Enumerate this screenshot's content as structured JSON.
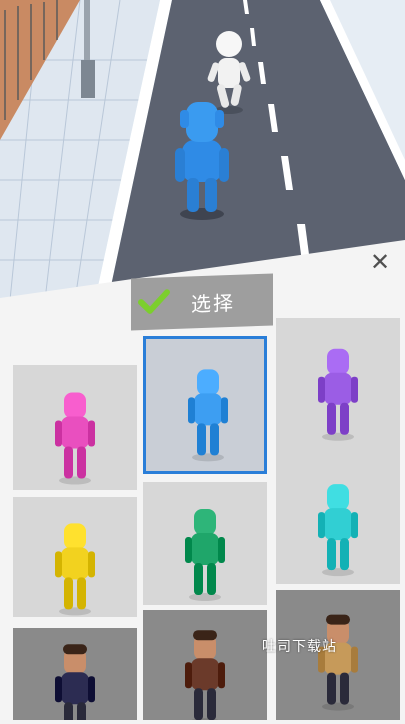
{
  "header": {
    "select_label": "选择",
    "close_icon": "close-icon",
    "check_icon": "checkmark-icon"
  },
  "colors": {
    "accent_green": "#7ccf2d",
    "selection_border": "#2a7ed8",
    "banner_grey": "#9e9e9e"
  },
  "characters": [
    {
      "id": "magenta",
      "color": "#e94fbf",
      "selected": false,
      "locked": false
    },
    {
      "id": "blue",
      "color": "#3d9ef2",
      "selected": true,
      "locked": false
    },
    {
      "id": "purple",
      "color": "#9b5de5",
      "selected": false,
      "locked": false
    },
    {
      "id": "yellow",
      "color": "#f2d21f",
      "selected": false,
      "locked": false
    },
    {
      "id": "green",
      "color": "#1fa66a",
      "selected": false,
      "locked": false
    },
    {
      "id": "cyan",
      "color": "#31cfd3",
      "selected": false,
      "locked": false
    },
    {
      "id": "businessman",
      "color": "#2c2c52",
      "selected": false,
      "locked": true
    },
    {
      "id": "bearded-man",
      "color": "#6b3a2a",
      "selected": false,
      "locked": true
    },
    {
      "id": "long-hair",
      "color": "#c69a5a",
      "selected": false,
      "locked": true
    }
  ],
  "watermark": "吐司下载站"
}
